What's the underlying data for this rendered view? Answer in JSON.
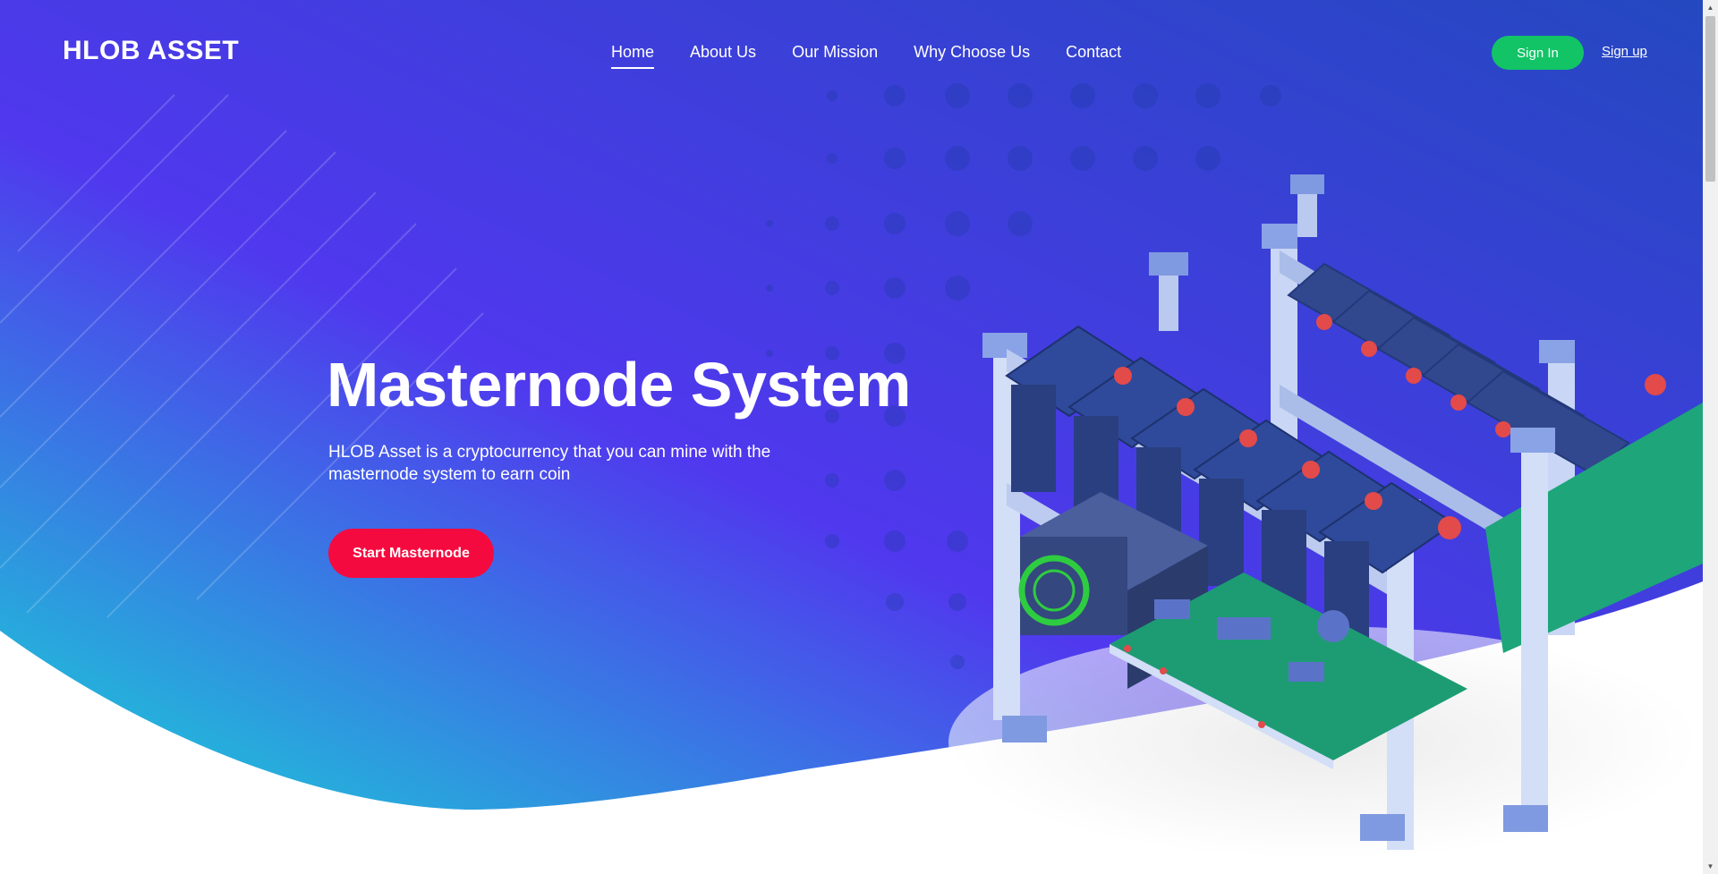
{
  "brand": {
    "logo_text": "HLOB ASSET"
  },
  "nav": {
    "items": [
      {
        "label": "Home",
        "active": true
      },
      {
        "label": "About Us"
      },
      {
        "label": "Our Mission"
      },
      {
        "label": "Why Choose Us"
      },
      {
        "label": "Contact"
      }
    ]
  },
  "auth": {
    "signin_label": "Sign In",
    "signup_label": "Sign up"
  },
  "hero": {
    "title": "Masternode System",
    "subtitle": "HLOB Asset is a cryptocurrency that you can mine with the masternode system to earn coin",
    "cta_label": "Start Masternode"
  },
  "colors": {
    "accent_cta": "#f50a3f",
    "signin_green": "#12c466",
    "gradient_start": "#19d2d6",
    "gradient_mid": "#5038ee",
    "gradient_end": "#2b4fc6"
  },
  "icons": {
    "scroll_up": "triangle-up-icon",
    "scroll_down": "triangle-down-icon"
  }
}
